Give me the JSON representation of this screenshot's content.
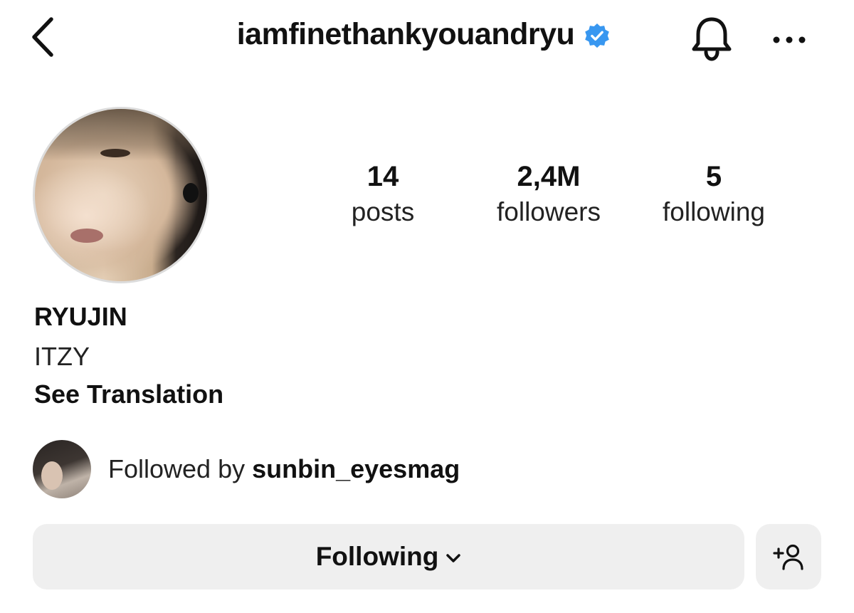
{
  "header": {
    "username": "iamfinethankyouandryu",
    "verified": true,
    "icons": {
      "back": "chevron-left-icon",
      "verified": "verified-badge-icon",
      "notifications": "bell-icon",
      "more": "more-horizontal-icon"
    }
  },
  "colors": {
    "verified_blue": "#3897f0",
    "button_bg": "#efefef",
    "text": "#111111"
  },
  "stats": {
    "posts": {
      "value": "14",
      "label": "posts"
    },
    "followers": {
      "value": "2,4M",
      "label": "followers"
    },
    "following": {
      "value": "5",
      "label": "following"
    }
  },
  "bio": {
    "name": "RYUJIN",
    "text": "ITZY",
    "translate_link": "See Translation"
  },
  "followed_by": {
    "prefix": "Followed by ",
    "user": "sunbin_eyesmag"
  },
  "actions": {
    "following_label": "Following",
    "following_icon": "chevron-down-icon",
    "add_user_icon": "add-user-icon"
  }
}
